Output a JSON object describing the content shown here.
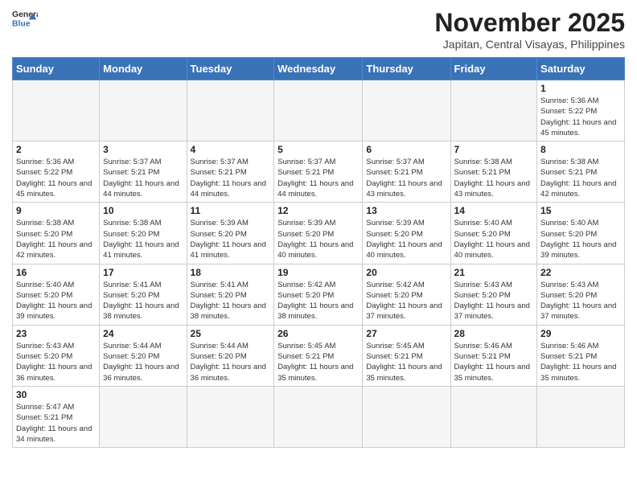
{
  "header": {
    "logo_general": "General",
    "logo_blue": "Blue",
    "month": "November 2025",
    "location": "Japitan, Central Visayas, Philippines"
  },
  "weekdays": [
    "Sunday",
    "Monday",
    "Tuesday",
    "Wednesday",
    "Thursday",
    "Friday",
    "Saturday"
  ],
  "weeks": [
    [
      {
        "day": "",
        "empty": true
      },
      {
        "day": "",
        "empty": true
      },
      {
        "day": "",
        "empty": true
      },
      {
        "day": "",
        "empty": true
      },
      {
        "day": "",
        "empty": true
      },
      {
        "day": "",
        "empty": true
      },
      {
        "day": "1",
        "sunrise": "5:36 AM",
        "sunset": "5:22 PM",
        "daylight": "11 hours and 45 minutes."
      }
    ],
    [
      {
        "day": "2",
        "sunrise": "5:36 AM",
        "sunset": "5:22 PM",
        "daylight": "11 hours and 45 minutes."
      },
      {
        "day": "3",
        "sunrise": "5:37 AM",
        "sunset": "5:21 PM",
        "daylight": "11 hours and 44 minutes."
      },
      {
        "day": "4",
        "sunrise": "5:37 AM",
        "sunset": "5:21 PM",
        "daylight": "11 hours and 44 minutes."
      },
      {
        "day": "5",
        "sunrise": "5:37 AM",
        "sunset": "5:21 PM",
        "daylight": "11 hours and 44 minutes."
      },
      {
        "day": "6",
        "sunrise": "5:37 AM",
        "sunset": "5:21 PM",
        "daylight": "11 hours and 43 minutes."
      },
      {
        "day": "7",
        "sunrise": "5:38 AM",
        "sunset": "5:21 PM",
        "daylight": "11 hours and 43 minutes."
      },
      {
        "day": "8",
        "sunrise": "5:38 AM",
        "sunset": "5:21 PM",
        "daylight": "11 hours and 42 minutes."
      }
    ],
    [
      {
        "day": "9",
        "sunrise": "5:38 AM",
        "sunset": "5:20 PM",
        "daylight": "11 hours and 42 minutes."
      },
      {
        "day": "10",
        "sunrise": "5:38 AM",
        "sunset": "5:20 PM",
        "daylight": "11 hours and 41 minutes."
      },
      {
        "day": "11",
        "sunrise": "5:39 AM",
        "sunset": "5:20 PM",
        "daylight": "11 hours and 41 minutes."
      },
      {
        "day": "12",
        "sunrise": "5:39 AM",
        "sunset": "5:20 PM",
        "daylight": "11 hours and 40 minutes."
      },
      {
        "day": "13",
        "sunrise": "5:39 AM",
        "sunset": "5:20 PM",
        "daylight": "11 hours and 40 minutes."
      },
      {
        "day": "14",
        "sunrise": "5:40 AM",
        "sunset": "5:20 PM",
        "daylight": "11 hours and 40 minutes."
      },
      {
        "day": "15",
        "sunrise": "5:40 AM",
        "sunset": "5:20 PM",
        "daylight": "11 hours and 39 minutes."
      }
    ],
    [
      {
        "day": "16",
        "sunrise": "5:40 AM",
        "sunset": "5:20 PM",
        "daylight": "11 hours and 39 minutes."
      },
      {
        "day": "17",
        "sunrise": "5:41 AM",
        "sunset": "5:20 PM",
        "daylight": "11 hours and 38 minutes."
      },
      {
        "day": "18",
        "sunrise": "5:41 AM",
        "sunset": "5:20 PM",
        "daylight": "11 hours and 38 minutes."
      },
      {
        "day": "19",
        "sunrise": "5:42 AM",
        "sunset": "5:20 PM",
        "daylight": "11 hours and 38 minutes."
      },
      {
        "day": "20",
        "sunrise": "5:42 AM",
        "sunset": "5:20 PM",
        "daylight": "11 hours and 37 minutes."
      },
      {
        "day": "21",
        "sunrise": "5:43 AM",
        "sunset": "5:20 PM",
        "daylight": "11 hours and 37 minutes."
      },
      {
        "day": "22",
        "sunrise": "5:43 AM",
        "sunset": "5:20 PM",
        "daylight": "11 hours and 37 minutes."
      }
    ],
    [
      {
        "day": "23",
        "sunrise": "5:43 AM",
        "sunset": "5:20 PM",
        "daylight": "11 hours and 36 minutes."
      },
      {
        "day": "24",
        "sunrise": "5:44 AM",
        "sunset": "5:20 PM",
        "daylight": "11 hours and 36 minutes."
      },
      {
        "day": "25",
        "sunrise": "5:44 AM",
        "sunset": "5:20 PM",
        "daylight": "11 hours and 36 minutes."
      },
      {
        "day": "26",
        "sunrise": "5:45 AM",
        "sunset": "5:21 PM",
        "daylight": "11 hours and 35 minutes."
      },
      {
        "day": "27",
        "sunrise": "5:45 AM",
        "sunset": "5:21 PM",
        "daylight": "11 hours and 35 minutes."
      },
      {
        "day": "28",
        "sunrise": "5:46 AM",
        "sunset": "5:21 PM",
        "daylight": "11 hours and 35 minutes."
      },
      {
        "day": "29",
        "sunrise": "5:46 AM",
        "sunset": "5:21 PM",
        "daylight": "11 hours and 35 minutes."
      }
    ],
    [
      {
        "day": "30",
        "sunrise": "5:47 AM",
        "sunset": "5:21 PM",
        "daylight": "11 hours and 34 minutes."
      },
      {
        "day": "",
        "empty": true
      },
      {
        "day": "",
        "empty": true
      },
      {
        "day": "",
        "empty": true
      },
      {
        "day": "",
        "empty": true
      },
      {
        "day": "",
        "empty": true
      },
      {
        "day": "",
        "empty": true
      }
    ]
  ],
  "labels": {
    "sunrise": "Sunrise:",
    "sunset": "Sunset:",
    "daylight": "Daylight:"
  }
}
